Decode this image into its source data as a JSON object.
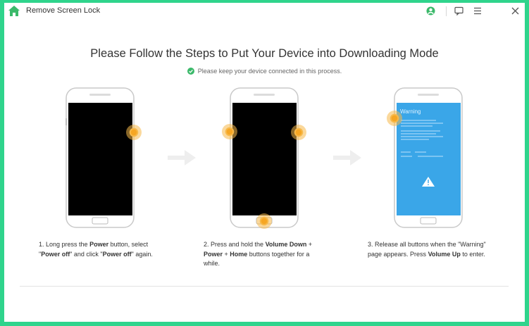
{
  "app": {
    "title": "Remove Screen Lock",
    "colors": {
      "accent": "#2fd48c",
      "brand": "#3bb96a",
      "warning_screen": "#3aa6e8"
    }
  },
  "header": {
    "headline": "Please Follow the Steps to Put Your Device into Downloading Mode",
    "notice": "Please keep your device connected in this process."
  },
  "steps": [
    {
      "parts": [
        "1. Long press the ",
        "Power",
        " button, select",
        "\"",
        "Power off",
        "\" and click \"",
        "Power off",
        "\" again."
      ]
    },
    {
      "parts": [
        "2. Press and hold the ",
        "Volume Down",
        " +",
        "Power",
        " + ",
        "Home",
        " buttons together for a",
        "while."
      ]
    },
    {
      "parts": [
        "3. Release all buttons when the \"Warning\"",
        "page appears. Press ",
        "Volume Up",
        " to enter."
      ]
    }
  ],
  "warning_screen": {
    "title": "Warning"
  },
  "icons": [
    "home-icon",
    "user-icon",
    "feedback-icon",
    "menu-icon",
    "close-icon",
    "check-circle-icon",
    "arrow-right-icon",
    "warning-triangle-icon"
  ]
}
